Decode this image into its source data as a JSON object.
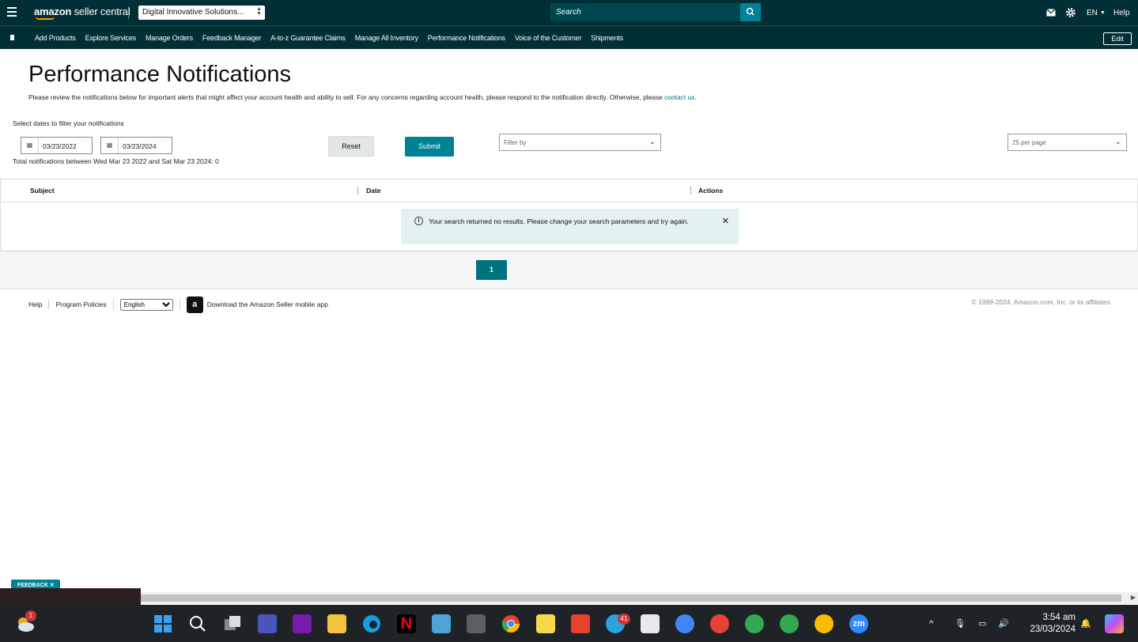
{
  "header": {
    "logo_text_bold": "amazon",
    "logo_text_rest": " seller central",
    "account": "Digital Innovative Solutions...",
    "search_placeholder": "Search",
    "language": "EN",
    "help": "Help"
  },
  "nav": {
    "items": [
      "Add Products",
      "Explore Services",
      "Manage Orders",
      "Feedback Manager",
      "A-to-z Guarantee Claims",
      "Manage All Inventory",
      "Performance Notifications",
      "Voice of the Customer",
      "Shipments"
    ],
    "edit": "Edit"
  },
  "page": {
    "title": "Performance Notifications",
    "description": "Please review the notifications below for important alerts that might affect your account health and ability to sell. For any concerns regarding account health, please respond to the notification directly. Otherwise, please ",
    "contact_link": "contact us.",
    "select_dates_label": "Select dates to filter your notifications",
    "start_date": "03/23/2022",
    "end_date": "03/23/2024",
    "reset": "Reset",
    "submit": "Submit",
    "filter_placeholder": "Filter by",
    "per_page": "25 per page",
    "total_text": "Total notifications between Wed Mar 23 2022 and Sat Mar 23 2024: 0"
  },
  "table": {
    "columns": [
      "Subject",
      "Date",
      "Actions"
    ],
    "alert_message": "Your search returned no results. Please change your search parameters and try again."
  },
  "pagination": {
    "current_page": "1"
  },
  "footer": {
    "help": "Help",
    "program_policies": "Program Policies",
    "language_option": "English",
    "download_app": "Download the Amazon Seller mobile app",
    "copyright": "© 1999-2024, Amazon.com, Inc. or its affiliates"
  },
  "feedback_tab": "FEEDBACK ✕",
  "taskbar": {
    "weather_badge": "1",
    "telegram_badge": "41",
    "time": "3:54 am",
    "date": "23/03/2024"
  },
  "colors": {
    "header_bg": "#002f36",
    "accent": "#008296",
    "alert_bg": "#e4f1f2"
  }
}
